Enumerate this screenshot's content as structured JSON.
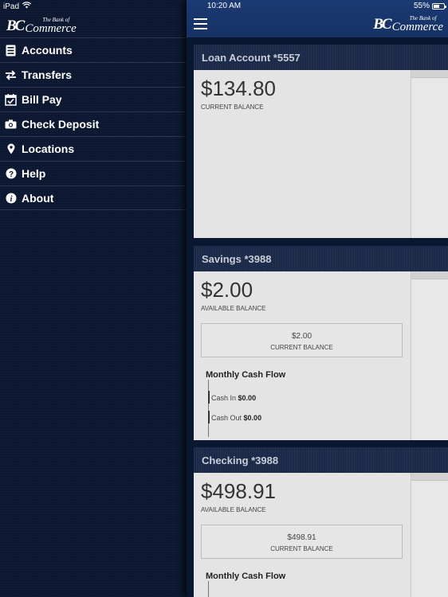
{
  "status": {
    "device": "iPad",
    "time": "10:20 AM",
    "battery": "55%",
    "battery_level": 0.55
  },
  "logo": {
    "mark": "BC",
    "small": "The Bank of",
    "big": "Commerce"
  },
  "menu": [
    {
      "label": "Accounts",
      "icon": "accounts-icon"
    },
    {
      "label": "Transfers",
      "icon": "transfer-arrows-icon"
    },
    {
      "label": "Bill Pay",
      "icon": "calendar-check-icon"
    },
    {
      "label": "Check Deposit",
      "icon": "camera-icon"
    },
    {
      "label": "Locations",
      "icon": "map-pin-icon"
    },
    {
      "label": "Help",
      "icon": "help-icon"
    },
    {
      "label": "About",
      "icon": "info-icon"
    }
  ],
  "accounts": [
    {
      "title": "Loan Account *5557",
      "amount": "$134.80",
      "amount_label": "CURRENT BALANCE"
    },
    {
      "title": "Savings *3988",
      "amount": "$2.00",
      "amount_label": "AVAILABLE BALANCE",
      "sub_amount": "$2.00",
      "sub_label": "CURRENT BALANCE",
      "flow_title": "Monthly Cash Flow",
      "cash_in_label": "Cash In",
      "cash_in": "$0.00",
      "cash_out_label": "Cash Out",
      "cash_out": "$0.00"
    },
    {
      "title": "Checking *3988",
      "amount": "$498.91",
      "amount_label": "AVAILABLE BALANCE",
      "sub_amount": "$498.91",
      "sub_label": "CURRENT BALANCE",
      "flow_title": "Monthly Cash Flow"
    }
  ]
}
